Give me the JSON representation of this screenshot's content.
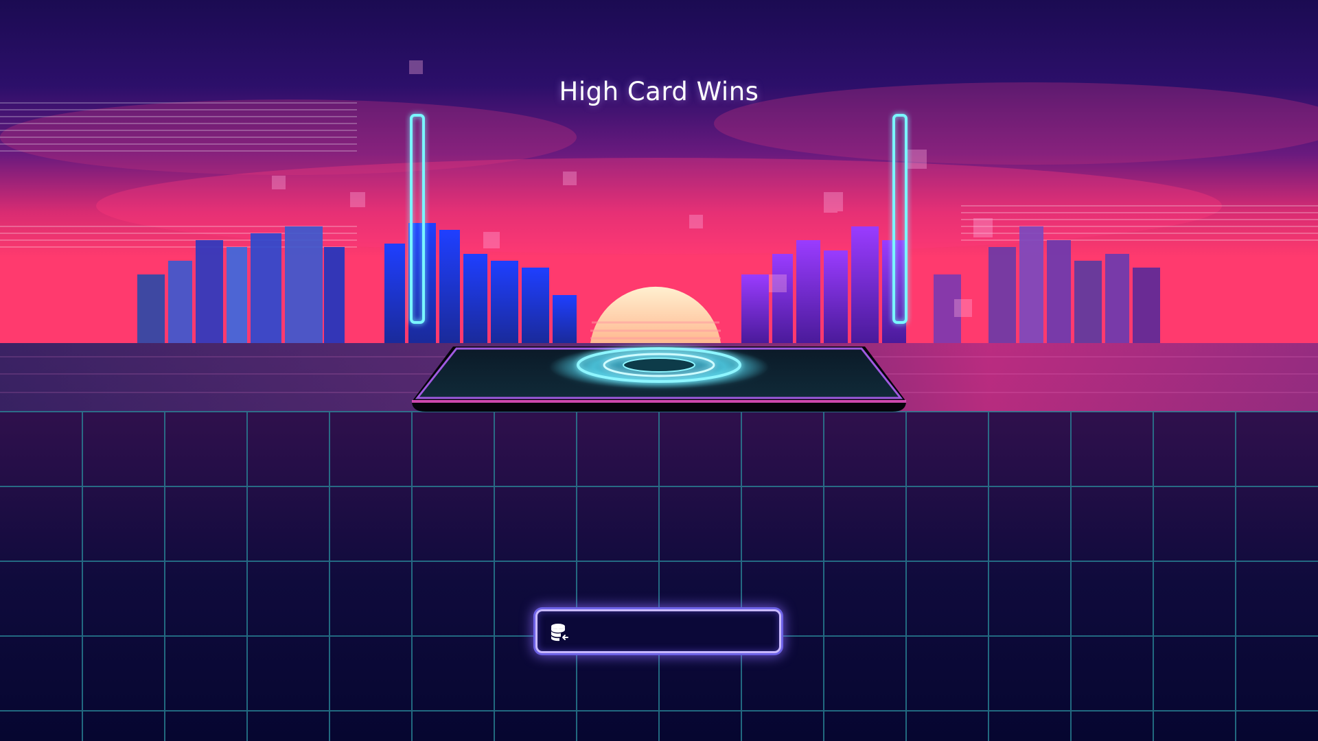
{
  "game": {
    "title": "High Card Wins"
  },
  "bet_input": {
    "icon": "coin-stack-icon",
    "value": ""
  },
  "colors": {
    "sky_top": "#1e0a58",
    "horizon_pink": "#ff2a78",
    "sun": "#ffd8b0",
    "grid_line": "#2a8a9a",
    "neon_cyan": "#7af6ff",
    "bet_border": "#c8b9ff"
  }
}
